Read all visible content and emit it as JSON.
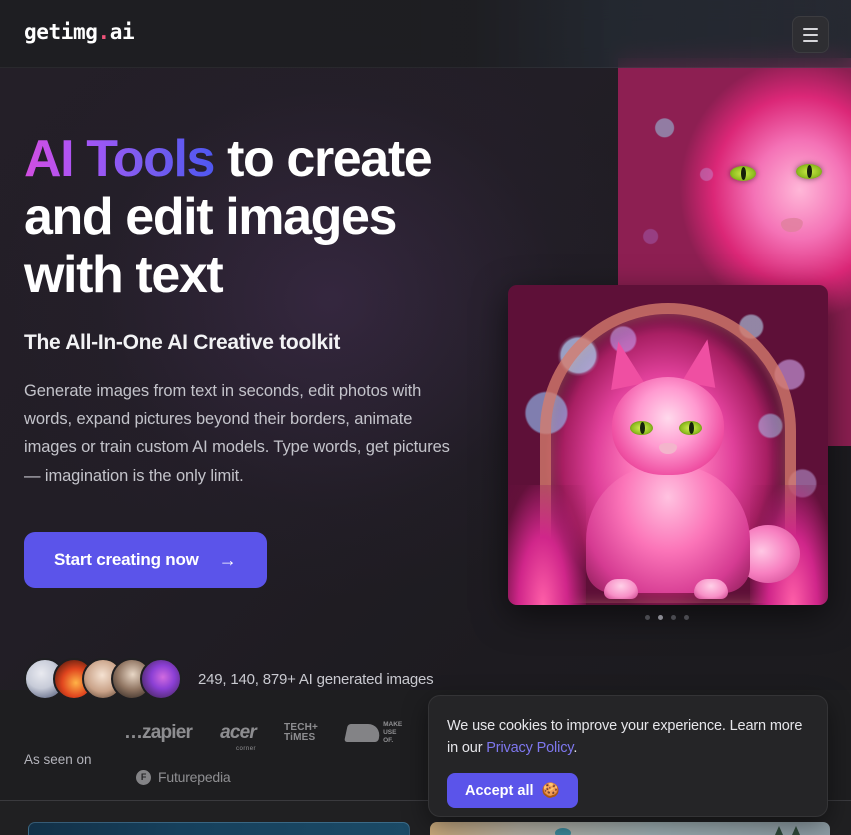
{
  "header": {
    "logo_main": "getimg",
    "logo_dot": ".",
    "logo_suffix": "ai",
    "menu_label": "Open menu"
  },
  "hero": {
    "headline_gradient": "AI Tools",
    "headline_rest": " to create and edit images with text",
    "subheadline": "The All-In-One AI Creative toolkit",
    "paragraph": "Generate images from text in seconds, edit photos with words, expand pictures beyond their borders, animate images or train custom AI models. Type words, get pictures — imagination is the only limit.",
    "cta_label": "Start creating now",
    "cta_arrow": "→",
    "accent_color": "#5b54ea",
    "gradient_from": "#d24ee0",
    "gradient_to": "#4f57f0"
  },
  "social_proof": {
    "stat_text": "249, 140, 879+ AI generated images",
    "avatar_count": 5
  },
  "as_seen_on": {
    "label": "As seen on",
    "brands": [
      {
        "name": "zapier",
        "text": "zapier"
      },
      {
        "name": "acer-corner",
        "text": "acer",
        "sub": "corner"
      },
      {
        "name": "tech-times",
        "line1": "TECH+",
        "line2": "TiMES"
      },
      {
        "name": "make-use-of",
        "line1": "MAKE",
        "line2": "USE",
        "line3": "OF."
      },
      {
        "name": "futurepedia",
        "text": "Futurepedia",
        "badge": "F"
      }
    ]
  },
  "carousel": {
    "dot_count": 4,
    "active_index": 1
  },
  "cookie_banner": {
    "text_before": "We use cookies to improve your experience. Learn more in our ",
    "link_label": "Privacy Policy",
    "text_after": ".",
    "accept_label": "Accept all",
    "accept_emoji": "🍪",
    "link_color": "#7e77ee"
  },
  "media": {
    "hero_card_alt": "pink-cat-bubbles-image",
    "hero_background_alt": "pink-cat-closeup-image"
  }
}
